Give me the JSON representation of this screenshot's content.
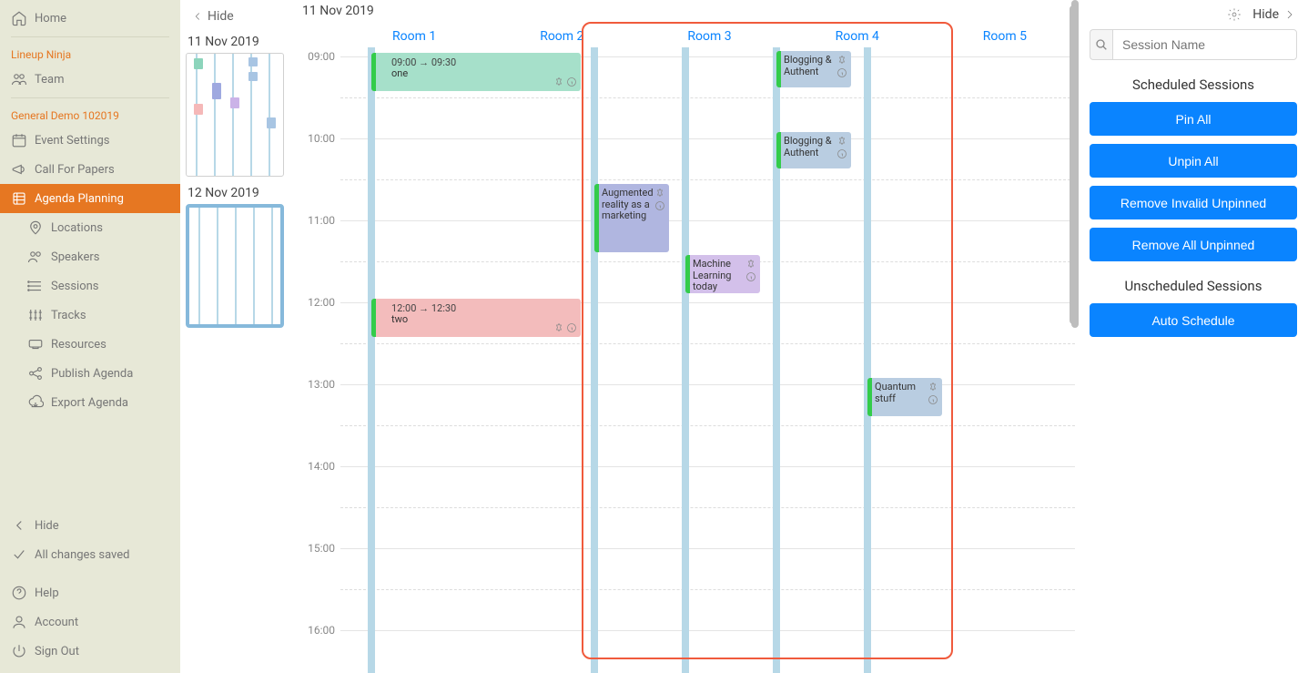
{
  "sidebar": {
    "home": "Home",
    "org": "Lineup Ninja",
    "team": "Team",
    "event": "General Demo 102019",
    "items": {
      "event_settings": "Event Settings",
      "call_for_papers": "Call For Papers",
      "agenda_planning": "Agenda Planning",
      "locations": "Locations",
      "speakers": "Speakers",
      "sessions": "Sessions",
      "tracks": "Tracks",
      "resources": "Resources",
      "publish_agenda": "Publish Agenda",
      "export_agenda": "Export Agenda"
    },
    "hide": "Hide",
    "saved": "All changes saved",
    "help": "Help",
    "account": "Account",
    "sign_out": "Sign Out"
  },
  "minimap": {
    "hide": "Hide",
    "dates": [
      "11 Nov 2019",
      "12 Nov 2019"
    ]
  },
  "calendar": {
    "date": "11 Nov 2019",
    "rooms": [
      "Room 1",
      "Room 2",
      "Room 3",
      "Room 4",
      "Room 5"
    ],
    "times": [
      "09:00",
      "10:00",
      "11:00",
      "12:00",
      "13:00",
      "14:00",
      "15:00",
      "16:00"
    ],
    "events": {
      "one": {
        "time": "09:00 → 09:30",
        "title": "one"
      },
      "two": {
        "time": "12:00 → 12:30",
        "title": "two"
      },
      "blog1": {
        "title": "Blogging & Authent"
      },
      "blog2": {
        "title": "Blogging & Authent"
      },
      "ar": {
        "title": "Augmented reality as a marketing"
      },
      "ml": {
        "title": "Machine Learning today"
      },
      "quantum": {
        "title": "Quantum stuff"
      }
    }
  },
  "right": {
    "hide": "Hide",
    "search_placeholder": "Session Name",
    "scheduled_h": "Scheduled Sessions",
    "pin_all": "Pin All",
    "unpin_all": "Unpin All",
    "remove_invalid": "Remove Invalid Unpinned",
    "remove_all": "Remove All Unpinned",
    "unscheduled_h": "Unscheduled Sessions",
    "auto_schedule": "Auto Schedule"
  }
}
